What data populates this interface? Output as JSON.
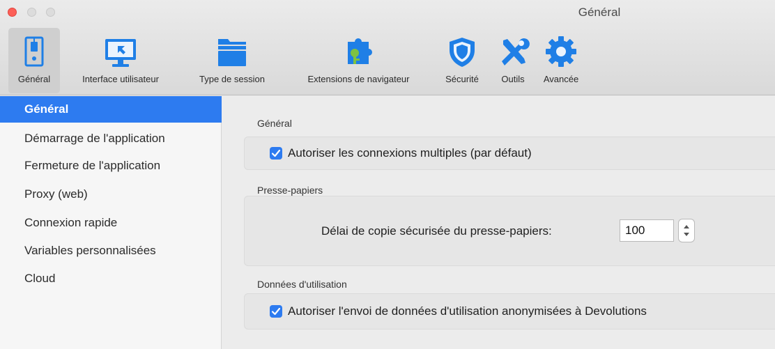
{
  "window": {
    "title": "Général"
  },
  "toolbar": {
    "items": [
      {
        "label": "Général",
        "icon": "switch-icon",
        "selected": true
      },
      {
        "label": "Interface utilisateur",
        "icon": "monitor-icon"
      },
      {
        "label": "Type de session",
        "icon": "folder-stack-icon"
      },
      {
        "label": "Extensions de navigateur",
        "icon": "puzzle-key-icon"
      },
      {
        "label": "Sécurité",
        "icon": "shield-icon"
      },
      {
        "label": "Outils",
        "icon": "tools-icon"
      },
      {
        "label": "Avancée",
        "icon": "gear-icon"
      }
    ]
  },
  "sidebar": {
    "items": [
      {
        "label": "Général",
        "active": true
      },
      {
        "label": "Démarrage de l'application"
      },
      {
        "label": "Fermeture de l'application"
      },
      {
        "label": "Proxy (web)"
      },
      {
        "label": "Connexion rapide"
      },
      {
        "label": "Variables personnalisées"
      },
      {
        "label": "Cloud"
      }
    ]
  },
  "main": {
    "general": {
      "title": "Général",
      "allow_multiple": {
        "label": "Autoriser les connexions multiples (par défaut)",
        "checked": true
      }
    },
    "clipboard": {
      "title": "Presse-papiers",
      "delay_label": "Délai de copie sécurisée du presse-papiers:",
      "delay_value": "100"
    },
    "usage": {
      "title": "Données d'utilisation",
      "send_usage": {
        "label": "Autoriser l'envoi de données d'utilisation anonymisées à Devolutions",
        "checked": true
      }
    }
  },
  "colors": {
    "accent": "#2d7bf0",
    "icon_blue": "#1f7fe6",
    "icon_green": "#7ec242"
  }
}
